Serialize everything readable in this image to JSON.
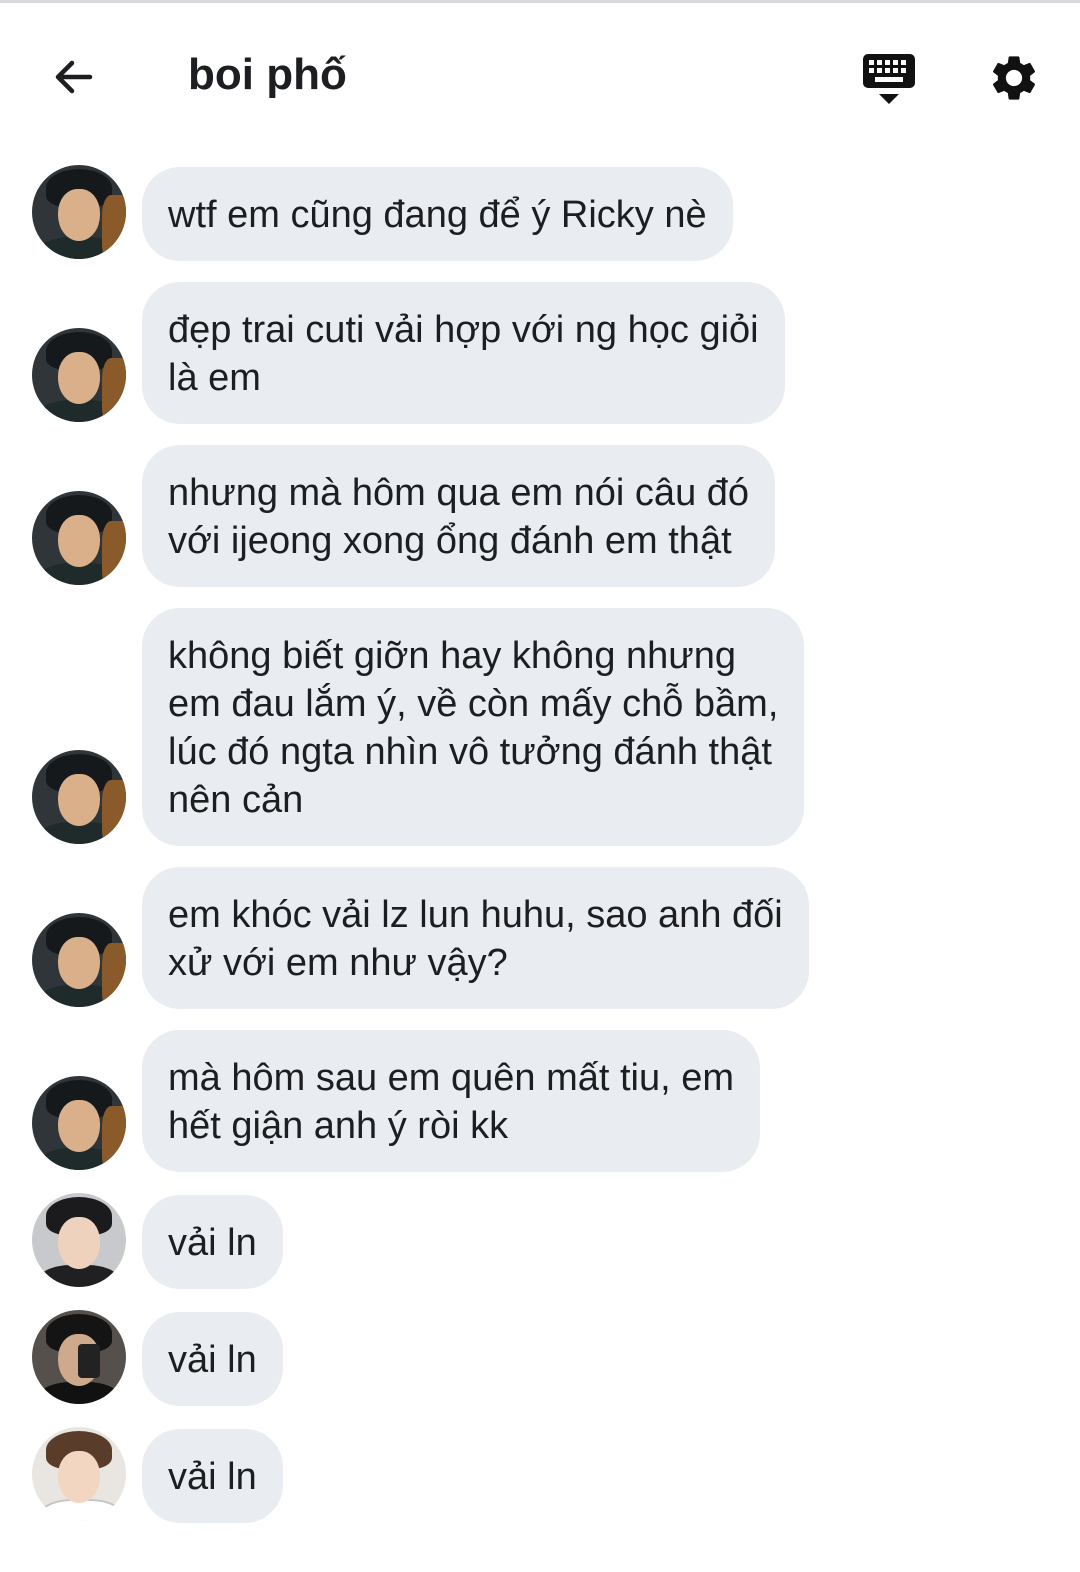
{
  "header": {
    "title": "boi phố",
    "back_icon": "arrow-left-icon",
    "keyboard_icon": "keyboard-icon",
    "settings_icon": "gear-icon"
  },
  "messages": [
    {
      "avatar": "a1",
      "text": "wtf em cũng đang để ý Ricky nè"
    },
    {
      "avatar": "a1",
      "text": "đẹp trai cuti vải hợp với ng học giỏi\nlà em"
    },
    {
      "avatar": "a1",
      "text": "nhưng mà hôm qua em nói câu đó\nvới ijeong xong ổng đánh em thật"
    },
    {
      "avatar": "a1",
      "text": "không biết giỡn hay không nhưng\nem đau lắm ý, về còn mấy chỗ bầm,\nlúc đó ngta nhìn vô tưởng đánh thật\nnên cản"
    },
    {
      "avatar": "a1",
      "text": "em khóc vải lz lun huhu, sao anh đối\nxử với em như vậy?"
    },
    {
      "avatar": "a1",
      "text": "mà hôm sau em quên mất tiu, em\nhết giận anh ý ròi kk"
    },
    {
      "avatar": "a2",
      "text": "vải ln"
    },
    {
      "avatar": "a3",
      "text": "vải ln"
    },
    {
      "avatar": "a4",
      "text": "vải ln"
    }
  ],
  "colors": {
    "bubble": "#e9ecf0",
    "text": "#1c1e21",
    "background": "#ffffff"
  }
}
